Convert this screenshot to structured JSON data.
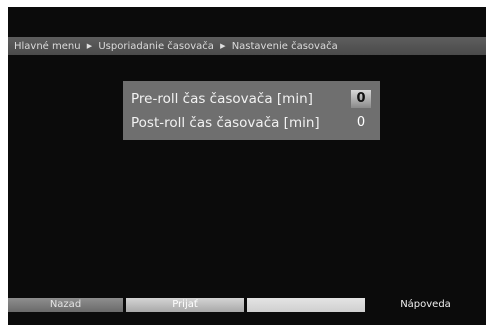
{
  "breadcrumb": {
    "items": [
      "Hlavné menu",
      "Usporiadanie časovača",
      "Nastavenie časovača"
    ]
  },
  "panel": {
    "rows": [
      {
        "label": "Pre-roll čas časovača [min]",
        "value": "0",
        "selected": true
      },
      {
        "label": "Post-roll čas časovača [min]",
        "value": "0",
        "selected": false
      }
    ]
  },
  "footer": {
    "back_label": "Nazad",
    "accept_label": "Prijať",
    "blank_label": "",
    "help_label": "Nápoveda"
  },
  "icons": {
    "breadcrumb_separator": "triangle-right-icon"
  },
  "colors": {
    "background": "#0b0b0b",
    "panel": "#6f6f6f",
    "breadcrumb_bar": "#555555",
    "selected_value": "#c8c8c8"
  }
}
